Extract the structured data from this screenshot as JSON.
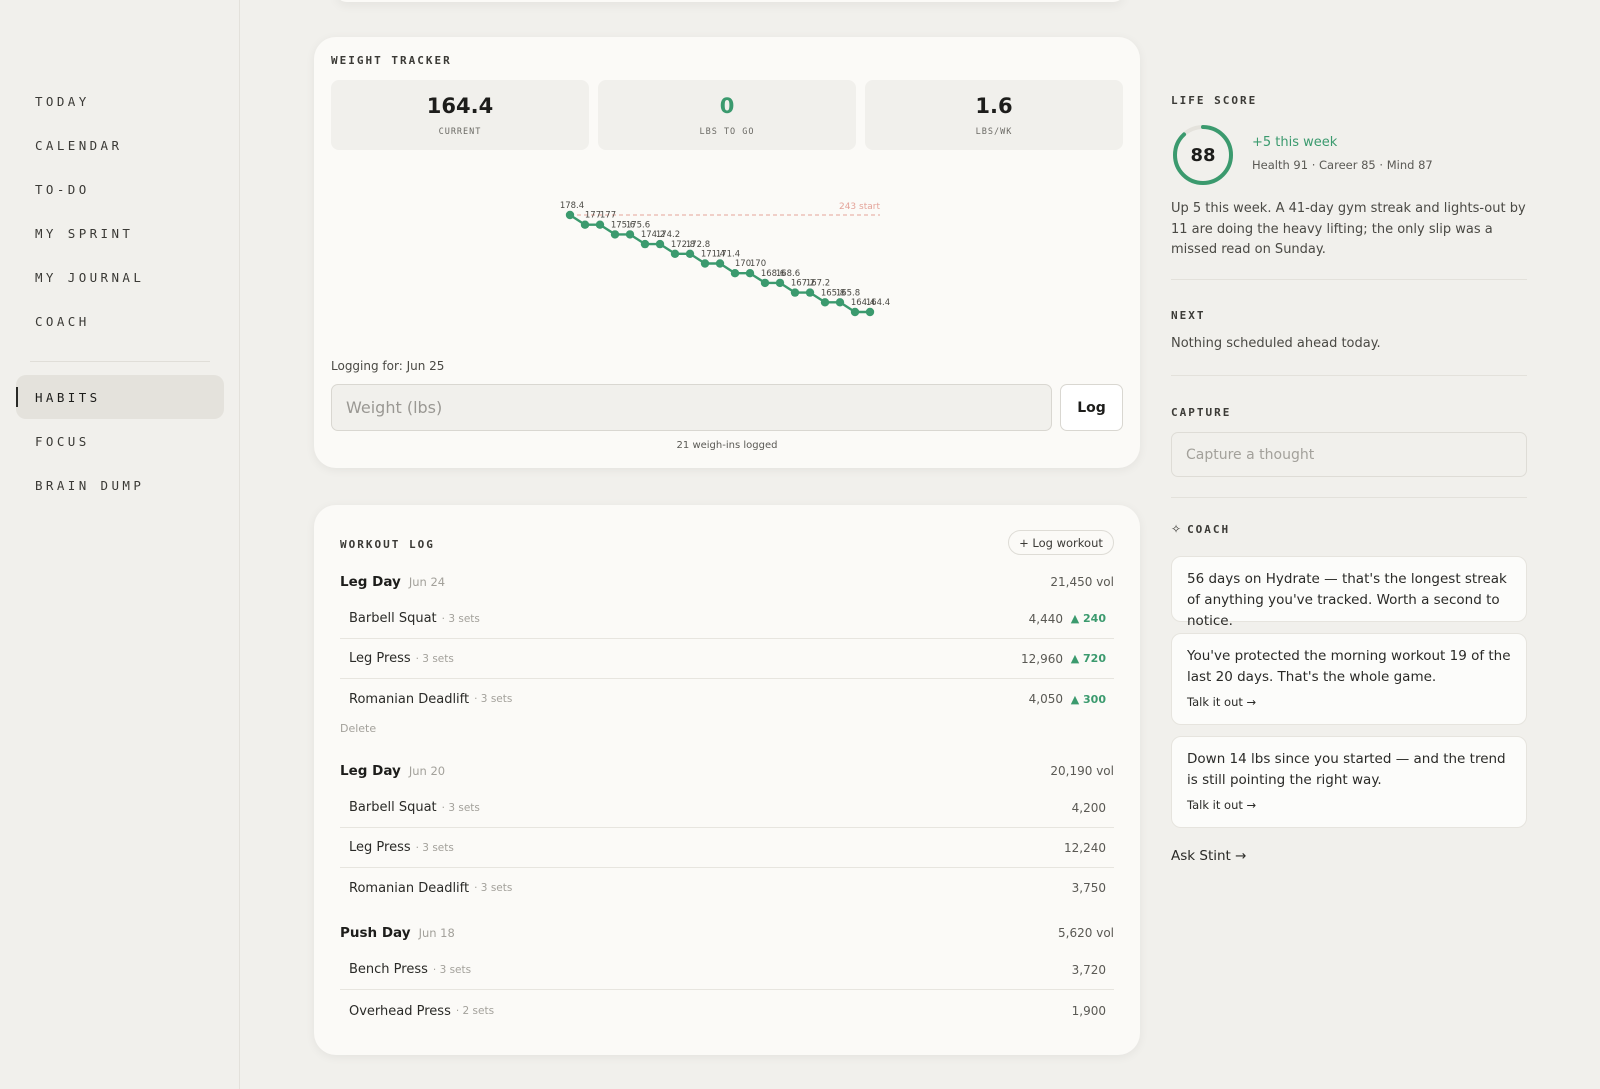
{
  "nav": {
    "items": [
      {
        "label": "TODAY"
      },
      {
        "label": "CALENDAR"
      },
      {
        "label": "TO-DO"
      },
      {
        "label": "MY SPRINT"
      },
      {
        "label": "MY JOURNAL"
      },
      {
        "label": "COACH"
      },
      {
        "label": "HABITS",
        "active": true
      },
      {
        "label": "FOCUS"
      },
      {
        "label": "BRAIN DUMP"
      }
    ]
  },
  "weight_tracker": {
    "title": "WEIGHT TRACKER",
    "stats": [
      {
        "value": "164.4",
        "label": "CURRENT"
      },
      {
        "value": "0",
        "label": "LBS TO GO"
      },
      {
        "value": "1.6",
        "label": "LBS/WK"
      }
    ],
    "logging_for": "Logging for: Jun 25",
    "input_placeholder": "Weight (lbs)",
    "log_button": "Log",
    "weighins": "21 weigh-ins logged"
  },
  "chart_data": {
    "type": "line",
    "series": [
      {
        "values": [
          178.4,
          177,
          177,
          175.6,
          175.6,
          174.2,
          174.2,
          172.8,
          172.8,
          171.4,
          171.4,
          170,
          170,
          168.6,
          168.6,
          167.2,
          167.2,
          165.8,
          165.8,
          164.4,
          164.4
        ]
      }
    ],
    "labels": [
      "178.4",
      "177",
      "177",
      "175.6",
      "175.6",
      "174.2",
      "174.2",
      "172.8",
      "172.8",
      "171.4",
      "171.4",
      "170",
      "170",
      "168.6",
      "168.6",
      "167.2",
      "167.2",
      "165.8",
      "165.8",
      "164.4",
      "164.4"
    ],
    "reference_line": {
      "label": "243 start"
    },
    "colors": {
      "line": "#3b9a6e",
      "reference": "#e4a49a"
    }
  },
  "workout_log": {
    "title": "WORKOUT LOG",
    "add_button": "+ Log workout",
    "delete_label": "Delete",
    "sessions": [
      {
        "name": "Leg Day",
        "date": "Jun 24",
        "volume": "21,450 vol",
        "exercises": [
          {
            "name": "Barbell Squat",
            "sets": "· 3 sets",
            "volume": "4,440",
            "delta": "▲ 240"
          },
          {
            "name": "Leg Press",
            "sets": "· 3 sets",
            "volume": "12,960",
            "delta": "▲ 720"
          },
          {
            "name": "Romanian Deadlift",
            "sets": "· 3 sets",
            "volume": "4,050",
            "delta": "▲ 300"
          }
        ]
      },
      {
        "name": "Leg Day",
        "date": "Jun 20",
        "volume": "20,190 vol",
        "exercises": [
          {
            "name": "Barbell Squat",
            "sets": "· 3 sets",
            "volume": "4,200"
          },
          {
            "name": "Leg Press",
            "sets": "· 3 sets",
            "volume": "12,240"
          },
          {
            "name": "Romanian Deadlift",
            "sets": "· 3 sets",
            "volume": "3,750"
          }
        ]
      },
      {
        "name": "Push Day",
        "date": "Jun 18",
        "volume": "5,620 vol",
        "exercises": [
          {
            "name": "Bench Press",
            "sets": "· 3 sets",
            "volume": "3,720"
          },
          {
            "name": "Overhead Press",
            "sets": "· 2 sets",
            "volume": "1,900"
          }
        ]
      }
    ]
  },
  "life_score": {
    "title": "LIFE SCORE",
    "score": "88",
    "score_fraction": 0.88,
    "change": "+5 this week",
    "breakdown": "Health 91 · Career 85 · Mind 87",
    "summary": "Up 5 this week. A 41-day gym streak and lights-out by 11 are doing the heavy lifting; the only slip was a missed read on Sunday."
  },
  "next": {
    "title": "NEXT",
    "text": "Nothing scheduled ahead today."
  },
  "capture": {
    "title": "CAPTURE",
    "placeholder": "Capture a thought"
  },
  "coach": {
    "title": "COACH",
    "cards": [
      {
        "text": "56 days on Hydrate — that's the longest streak of anything you've tracked. Worth a second to notice."
      },
      {
        "text": "You've protected the morning workout 19 of the last 20 days. That's the whole game.",
        "link": "Talk it out →"
      },
      {
        "text": "Down 14 lbs since you started — and the trend is still pointing the right way.",
        "link": "Talk it out →"
      }
    ],
    "ask": "Ask Stint →"
  },
  "colors": {
    "accent": "#3b9a6e",
    "background": "#f1f0ec",
    "card": "#fbfaf7"
  }
}
